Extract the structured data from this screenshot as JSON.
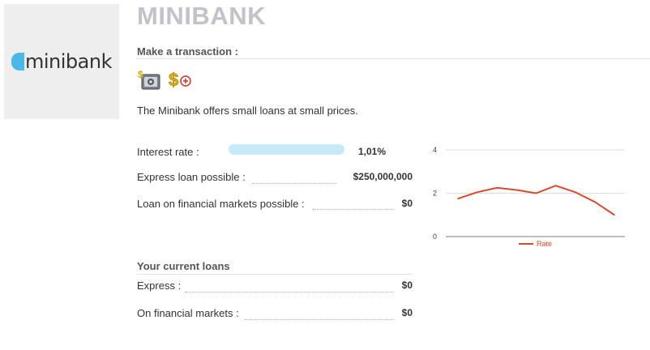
{
  "logo": {
    "text": "minibank"
  },
  "title": "MINIBANK",
  "transaction": {
    "label": "Make a transaction :",
    "icons": [
      "safe-money-icon",
      "dollar-exchange-icon"
    ]
  },
  "description": "The Minibank offers small loans at small prices.",
  "rates": {
    "interest_label": "Interest rate :",
    "interest_value": "1,01%",
    "express_label": "Express loan possible :",
    "express_value": "$250,000,000",
    "markets_label": "Loan on financial markets possible :",
    "markets_value": "$0"
  },
  "current_loans": {
    "label": "Your current loans",
    "express_label": "Express :",
    "express_value": "$0",
    "markets_label": "On financial markets :",
    "markets_value": "$0"
  },
  "chart_data": {
    "type": "line",
    "x": [
      1,
      2,
      3,
      4,
      5,
      6,
      7,
      8,
      9
    ],
    "series": [
      {
        "name": "Rate",
        "values": [
          1.75,
          2.05,
          2.25,
          2.15,
          2.0,
          2.35,
          2.05,
          1.6,
          1.0
        ],
        "color": "#d84a2a"
      }
    ],
    "ylim": [
      0,
      4
    ],
    "yticks": [
      "0",
      "2",
      "4"
    ],
    "legend": "bottom",
    "grid": true
  },
  "colors": {
    "rate_bar": "#c8e9f8",
    "title": "#c2c2c8",
    "logo_accent": "#4bb8e6"
  }
}
